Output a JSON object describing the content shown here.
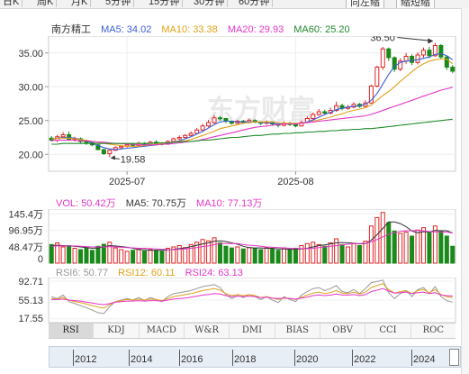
{
  "toolbar": {
    "tabs": [
      "日K",
      "周K",
      "月K",
      "5分钟",
      "15分钟",
      "30分钟",
      "60分钟"
    ],
    "buttons": [
      "向左缩",
      "缩短缩"
    ]
  },
  "main": {
    "stock_name": "南方精工",
    "ma": [
      {
        "label": "MA5: 34.02",
        "color": "#3a5fd6"
      },
      {
        "label": "MA10: 33.38",
        "color": "#e0a21a"
      },
      {
        "label": "MA20: 29.93",
        "color": "#e536c8"
      },
      {
        "label": "MA60: 25.20",
        "color": "#1e8a2a"
      }
    ],
    "watermark": "东方财富",
    "high_label": "36.50",
    "low_label": "19.58"
  },
  "volume": {
    "legend": [
      {
        "label": "VOL: 50.42万",
        "color": "#e536c8"
      },
      {
        "label": "MA5: 70.75万",
        "color": "#333333"
      },
      {
        "label": "MA10: 77.13万",
        "color": "#e536c8"
      }
    ]
  },
  "rsi": {
    "legend": [
      {
        "label": "RSI6: 50.77",
        "color": "#999999"
      },
      {
        "label": "RSI12: 60.11",
        "color": "#e0a21a"
      },
      {
        "label": "RSI24: 63.13",
        "color": "#e536c8"
      }
    ]
  },
  "indicator_tabs": [
    "RSI",
    "KDJ",
    "MACD",
    "W&R",
    "DMI",
    "BIAS",
    "OBV",
    "CCI",
    "ROC"
  ],
  "active_indicator": "RSI",
  "timeline": [
    "2012",
    "2014",
    "2016",
    "2018",
    "2020",
    "2022",
    "2024"
  ],
  "chart_data": [
    {
      "type": "candlestick",
      "ylim": [
        17.5,
        37.5
      ],
      "yticks": [
        20,
        25,
        30,
        35
      ],
      "ytick_labels": [
        "20.00",
        "25.00",
        "30.00",
        "35.00"
      ],
      "xtick_labels": [
        "2025-07",
        "2025-08"
      ],
      "xtick_index": [
        13,
        42
      ],
      "colors": {
        "up": "#e02525",
        "down": "#1a8a1a"
      },
      "candles": [
        [
          22.4,
          22.1,
          22.7,
          21.9
        ],
        [
          22.1,
          22.6,
          22.9,
          21.8
        ],
        [
          22.6,
          22.9,
          23.3,
          22.3
        ],
        [
          22.9,
          22.2,
          23.4,
          22.0
        ],
        [
          22.2,
          22.3,
          22.6,
          21.9
        ],
        [
          22.3,
          21.9,
          22.5,
          21.6
        ],
        [
          21.9,
          21.7,
          22.1,
          21.4
        ],
        [
          21.7,
          21.4,
          21.9,
          21.2
        ],
        [
          21.4,
          20.7,
          21.5,
          20.6
        ],
        [
          20.7,
          20.1,
          20.8,
          19.9
        ],
        [
          20.1,
          20.6,
          20.8,
          19.58
        ],
        [
          20.6,
          21.0,
          21.2,
          20.5
        ],
        [
          21.0,
          21.2,
          21.4,
          20.8
        ],
        [
          21.2,
          21.4,
          21.6,
          21.0
        ],
        [
          21.4,
          21.3,
          21.7,
          21.1
        ],
        [
          21.3,
          21.6,
          21.9,
          21.2
        ],
        [
          21.6,
          21.4,
          21.8,
          21.2
        ],
        [
          21.4,
          21.8,
          22.0,
          21.3
        ],
        [
          21.8,
          21.6,
          22.1,
          21.4
        ],
        [
          21.6,
          21.5,
          21.8,
          21.3
        ],
        [
          21.5,
          21.9,
          22.1,
          21.4
        ],
        [
          21.9,
          22.3,
          22.5,
          21.8
        ],
        [
          22.3,
          22.5,
          22.8,
          22.1
        ],
        [
          22.5,
          22.8,
          23.0,
          22.3
        ],
        [
          22.8,
          23.1,
          23.4,
          22.7
        ],
        [
          23.1,
          23.6,
          23.9,
          23.0
        ],
        [
          23.6,
          24.2,
          24.5,
          23.4
        ],
        [
          24.2,
          24.7,
          25.1,
          24.0
        ],
        [
          24.7,
          25.4,
          25.8,
          24.5
        ],
        [
          25.4,
          25.3,
          25.7,
          25.0
        ],
        [
          25.3,
          24.9,
          25.4,
          24.6
        ],
        [
          24.9,
          24.6,
          25.0,
          24.4
        ],
        [
          24.6,
          24.9,
          25.1,
          24.5
        ],
        [
          24.9,
          24.7,
          25.1,
          24.5
        ],
        [
          24.7,
          25.0,
          25.3,
          24.6
        ],
        [
          25.0,
          24.8,
          25.2,
          24.6
        ],
        [
          24.8,
          24.6,
          24.9,
          24.3
        ],
        [
          24.6,
          24.8,
          25.0,
          24.4
        ],
        [
          24.8,
          24.5,
          24.9,
          24.2
        ],
        [
          24.5,
          24.3,
          24.6,
          24.0
        ],
        [
          24.3,
          24.6,
          24.9,
          24.1
        ],
        [
          24.6,
          24.4,
          24.8,
          24.2
        ],
        [
          24.4,
          24.2,
          24.6,
          24.0
        ],
        [
          24.2,
          24.7,
          25.0,
          24.1
        ],
        [
          24.7,
          25.3,
          25.6,
          24.6
        ],
        [
          25.3,
          25.9,
          26.2,
          25.1
        ],
        [
          25.9,
          26.3,
          26.7,
          25.7
        ],
        [
          26.3,
          26.1,
          26.6,
          25.8
        ],
        [
          26.1,
          26.5,
          26.9,
          25.9
        ],
        [
          26.5,
          27.2,
          27.8,
          26.3
        ],
        [
          27.2,
          26.8,
          27.5,
          26.5
        ],
        [
          26.8,
          27.0,
          27.3,
          26.6
        ],
        [
          27.0,
          27.4,
          27.7,
          26.8
        ],
        [
          27.4,
          27.1,
          27.6,
          26.9
        ],
        [
          27.1,
          27.6,
          28.0,
          26.9
        ],
        [
          27.6,
          30.1,
          30.3,
          27.5
        ],
        [
          30.1,
          32.9,
          33.1,
          29.9
        ],
        [
          32.9,
          35.6,
          35.9,
          32.5
        ],
        [
          35.6,
          34.3,
          35.8,
          33.8
        ],
        [
          34.3,
          32.6,
          34.5,
          32.2
        ],
        [
          32.6,
          33.8,
          34.2,
          32.3
        ],
        [
          33.8,
          34.5,
          35.0,
          33.4
        ],
        [
          34.5,
          33.6,
          34.8,
          33.2
        ],
        [
          33.6,
          34.7,
          35.1,
          33.3
        ],
        [
          34.7,
          35.4,
          35.8,
          34.3
        ],
        [
          35.4,
          34.6,
          35.9,
          34.2
        ],
        [
          34.6,
          36.1,
          36.5,
          34.4
        ],
        [
          36.1,
          34.4,
          36.3,
          34.1
        ],
        [
          34.4,
          32.9,
          34.6,
          32.5
        ],
        [
          32.9,
          32.3,
          33.2,
          32.0
        ]
      ],
      "ma": {
        "MA5": [
          22.3,
          22.4,
          22.5,
          22.5,
          22.4,
          22.2,
          22.0,
          21.7,
          21.3,
          21.0,
          20.8,
          20.7,
          20.8,
          20.9,
          21.0,
          21.1,
          21.2,
          21.3,
          21.4,
          21.5,
          21.6,
          21.8,
          22.0,
          22.3,
          22.6,
          23.0,
          23.4,
          23.9,
          24.4,
          24.8,
          24.9,
          24.9,
          24.8,
          24.8,
          24.8,
          24.8,
          24.7,
          24.7,
          24.6,
          24.5,
          24.5,
          24.5,
          24.5,
          24.6,
          24.8,
          25.1,
          25.5,
          25.9,
          26.2,
          26.6,
          26.8,
          27.0,
          27.1,
          27.2,
          27.4,
          28.0,
          29.0,
          30.4,
          31.8,
          33.0,
          33.6,
          33.8,
          33.9,
          34.0,
          34.2,
          34.4,
          34.8,
          34.9,
          34.6,
          34.0
        ],
        "MA10": [
          22.3,
          22.4,
          22.4,
          22.4,
          22.3,
          22.2,
          22.1,
          21.9,
          21.8,
          21.6,
          21.5,
          21.4,
          21.3,
          21.2,
          21.2,
          21.2,
          21.3,
          21.4,
          21.5,
          21.6,
          21.7,
          21.8,
          21.9,
          22.0,
          22.2,
          22.5,
          22.8,
          23.1,
          23.4,
          23.8,
          24.0,
          24.2,
          24.4,
          24.6,
          24.7,
          24.8,
          24.8,
          24.8,
          24.8,
          24.7,
          24.6,
          24.6,
          24.6,
          24.6,
          24.7,
          24.9,
          25.1,
          25.3,
          25.5,
          25.8,
          26.0,
          26.3,
          26.5,
          26.7,
          26.9,
          27.3,
          28.0,
          28.7,
          29.3,
          30.0,
          30.8,
          31.5,
          32.2,
          32.9,
          33.4,
          33.8,
          34.0,
          34.1,
          34.1,
          33.4
        ],
        "MA20": [
          22.0,
          22.1,
          22.1,
          22.1,
          22.1,
          22.0,
          22.0,
          21.9,
          21.8,
          21.8,
          21.7,
          21.6,
          21.6,
          21.5,
          21.5,
          21.4,
          21.4,
          21.4,
          21.4,
          21.5,
          21.5,
          21.6,
          21.7,
          21.8,
          21.9,
          22.0,
          22.2,
          22.4,
          22.6,
          22.8,
          23.0,
          23.2,
          23.4,
          23.6,
          23.8,
          24.0,
          24.1,
          24.2,
          24.3,
          24.4,
          24.5,
          24.5,
          24.5,
          24.6,
          24.7,
          24.8,
          24.9,
          25.0,
          25.1,
          25.2,
          25.3,
          25.4,
          25.5,
          25.6,
          25.7,
          25.9,
          26.2,
          26.5,
          26.8,
          27.1,
          27.4,
          27.7,
          28.0,
          28.3,
          28.6,
          28.9,
          29.2,
          29.5,
          29.7,
          29.93
        ],
        "MA60": [
          21.5,
          21.5,
          21.6,
          21.6,
          21.6,
          21.6,
          21.6,
          21.6,
          21.6,
          21.6,
          21.6,
          21.6,
          21.6,
          21.6,
          21.6,
          21.6,
          21.6,
          21.6,
          21.7,
          21.7,
          21.7,
          21.8,
          21.8,
          21.9,
          21.9,
          22.0,
          22.1,
          22.1,
          22.2,
          22.3,
          22.4,
          22.5,
          22.5,
          22.6,
          22.7,
          22.8,
          22.8,
          22.9,
          23.0,
          23.0,
          23.1,
          23.1,
          23.2,
          23.2,
          23.3,
          23.3,
          23.4,
          23.4,
          23.5,
          23.5,
          23.6,
          23.6,
          23.7,
          23.7,
          23.8,
          23.8,
          23.9,
          24.0,
          24.1,
          24.2,
          24.3,
          24.4,
          24.5,
          24.6,
          24.7,
          24.8,
          24.9,
          25.0,
          25.1,
          25.2
        ]
      }
    },
    {
      "type": "bar",
      "ylim": [
        0,
        160
      ],
      "yticks": [
        0,
        48.47,
        96.95,
        145.4
      ],
      "ytick_labels": [
        "0",
        "48.47万",
        "96.95万",
        "145.4万"
      ],
      "unit": "万",
      "values": [
        55,
        60,
        48,
        52,
        44,
        40,
        46,
        38,
        50,
        56,
        62,
        45,
        40,
        35,
        38,
        42,
        36,
        40,
        38,
        35,
        44,
        48,
        52,
        46,
        55,
        62,
        70,
        66,
        75,
        60,
        50,
        45,
        48,
        42,
        46,
        44,
        40,
        46,
        42,
        38,
        45,
        40,
        44,
        52,
        58,
        62,
        55,
        50,
        60,
        72,
        55,
        48,
        58,
        52,
        65,
        110,
        135,
        150,
        120,
        95,
        88,
        92,
        80,
        98,
        105,
        92,
        110,
        95,
        80,
        50
      ],
      "ma5": [
        52,
        53,
        52,
        51,
        50,
        48,
        46,
        44,
        45,
        48,
        52,
        51,
        49,
        47,
        44,
        40,
        40,
        38,
        38,
        38,
        39,
        41,
        43,
        45,
        49,
        53,
        57,
        60,
        65,
        66,
        64,
        60,
        56,
        50,
        46,
        45,
        45,
        44,
        44,
        42,
        42,
        41,
        41,
        42,
        44,
        48,
        52,
        54,
        57,
        60,
        61,
        60,
        59,
        57,
        58,
        68,
        84,
        103,
        122,
        122,
        117,
        108,
        95,
        90,
        93,
        92,
        97,
        96,
        96,
        89
      ],
      "ma10": [
        50,
        51,
        51,
        51,
        51,
        50,
        49,
        48,
        48,
        48,
        49,
        48,
        47,
        46,
        45,
        44,
        44,
        43,
        42,
        41,
        40,
        40,
        41,
        42,
        44,
        46,
        49,
        51,
        55,
        58,
        58,
        58,
        58,
        55,
        53,
        52,
        50,
        48,
        47,
        46,
        45,
        44,
        43,
        43,
        43,
        44,
        46,
        48,
        50,
        52,
        54,
        56,
        58,
        58,
        59,
        63,
        70,
        78,
        86,
        90,
        94,
        96,
        96,
        97,
        96,
        93,
        93,
        92,
        92,
        89
      ]
    },
    {
      "type": "line",
      "ylim": [
        10,
        100
      ],
      "yticks": [
        17.55,
        55.13,
        92.71
      ],
      "ytick_labels": [
        "17.55",
        "55.13",
        "92.71"
      ],
      "series": [
        {
          "name": "RSI6",
          "color": "#999999",
          "values": [
            62,
            58,
            65,
            52,
            48,
            44,
            40,
            35,
            30,
            28,
            42,
            52,
            55,
            58,
            55,
            60,
            54,
            60,
            56,
            52,
            62,
            68,
            70,
            72,
            74,
            78,
            82,
            84,
            86,
            80,
            66,
            58,
            64,
            60,
            66,
            62,
            56,
            62,
            55,
            50,
            62,
            56,
            52,
            65,
            72,
            78,
            80,
            74,
            78,
            84,
            72,
            70,
            76,
            68,
            78,
            90,
            92,
            95,
            70,
            58,
            68,
            74,
            62,
            76,
            80,
            68,
            82,
            62,
            54,
            50.77
          ]
        },
        {
          "name": "RSI12",
          "color": "#e0a21a",
          "values": [
            58,
            57,
            60,
            55,
            52,
            50,
            47,
            44,
            41,
            39,
            46,
            52,
            54,
            56,
            55,
            57,
            55,
            57,
            56,
            54,
            58,
            62,
            64,
            66,
            68,
            71,
            74,
            76,
            78,
            75,
            68,
            64,
            66,
            64,
            66,
            64,
            60,
            62,
            59,
            56,
            60,
            58,
            56,
            61,
            65,
            69,
            71,
            68,
            70,
            74,
            69,
            68,
            71,
            67,
            71,
            80,
            84,
            88,
            76,
            69,
            72,
            74,
            68,
            74,
            76,
            70,
            76,
            66,
            62,
            60.11
          ]
        },
        {
          "name": "RSI24",
          "color": "#e536c8",
          "values": [
            56,
            56,
            57,
            55,
            54,
            53,
            51,
            49,
            47,
            46,
            48,
            51,
            52,
            53,
            53,
            54,
            53,
            54,
            54,
            53,
            55,
            57,
            58,
            59,
            61,
            63,
            65,
            66,
            68,
            67,
            64,
            62,
            63,
            62,
            63,
            62,
            60,
            61,
            59,
            58,
            59,
            58,
            57,
            59,
            61,
            64,
            65,
            64,
            65,
            67,
            65,
            65,
            66,
            64,
            66,
            72,
            75,
            78,
            73,
            69,
            70,
            71,
            68,
            70,
            71,
            68,
            70,
            65,
            64,
            63.13
          ]
        }
      ]
    }
  ]
}
